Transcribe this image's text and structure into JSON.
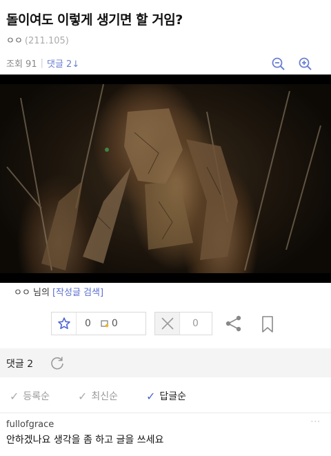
{
  "post": {
    "title": "돌이여도 이렇게 생기면 할 거임?",
    "author_name": "ㅇㅇ",
    "author_ip": "(211.105)",
    "views_label": "조회 91",
    "comments_link": "댓글 2↓"
  },
  "author_search": {
    "suffix": "ㅇㅇ 님의",
    "link": "[작성글 검색]"
  },
  "recommend": {
    "up_count": "0",
    "fix_count": "0",
    "down_count": "0"
  },
  "comments_section": {
    "label": "댓글 2",
    "sort_options": [
      {
        "label": "등록순",
        "active": false
      },
      {
        "label": "최신순",
        "active": false
      },
      {
        "label": "답글순",
        "active": true
      }
    ],
    "items": [
      {
        "nick": "fullofgrace",
        "body": "안하겠나요 생각을 좀 하고 글을 쓰세요",
        "more": "···"
      }
    ]
  },
  "icons": {
    "zoom_out": "zoom-out-icon",
    "zoom_in": "zoom-in-icon",
    "star": "star-icon",
    "fix": "fix-icon",
    "close": "close-icon",
    "share": "share-icon",
    "bookmark": "bookmark-icon",
    "refresh": "refresh-icon"
  },
  "colors": {
    "accent": "#4a64d2",
    "link": "#5b6fd0",
    "muted": "#999999"
  }
}
